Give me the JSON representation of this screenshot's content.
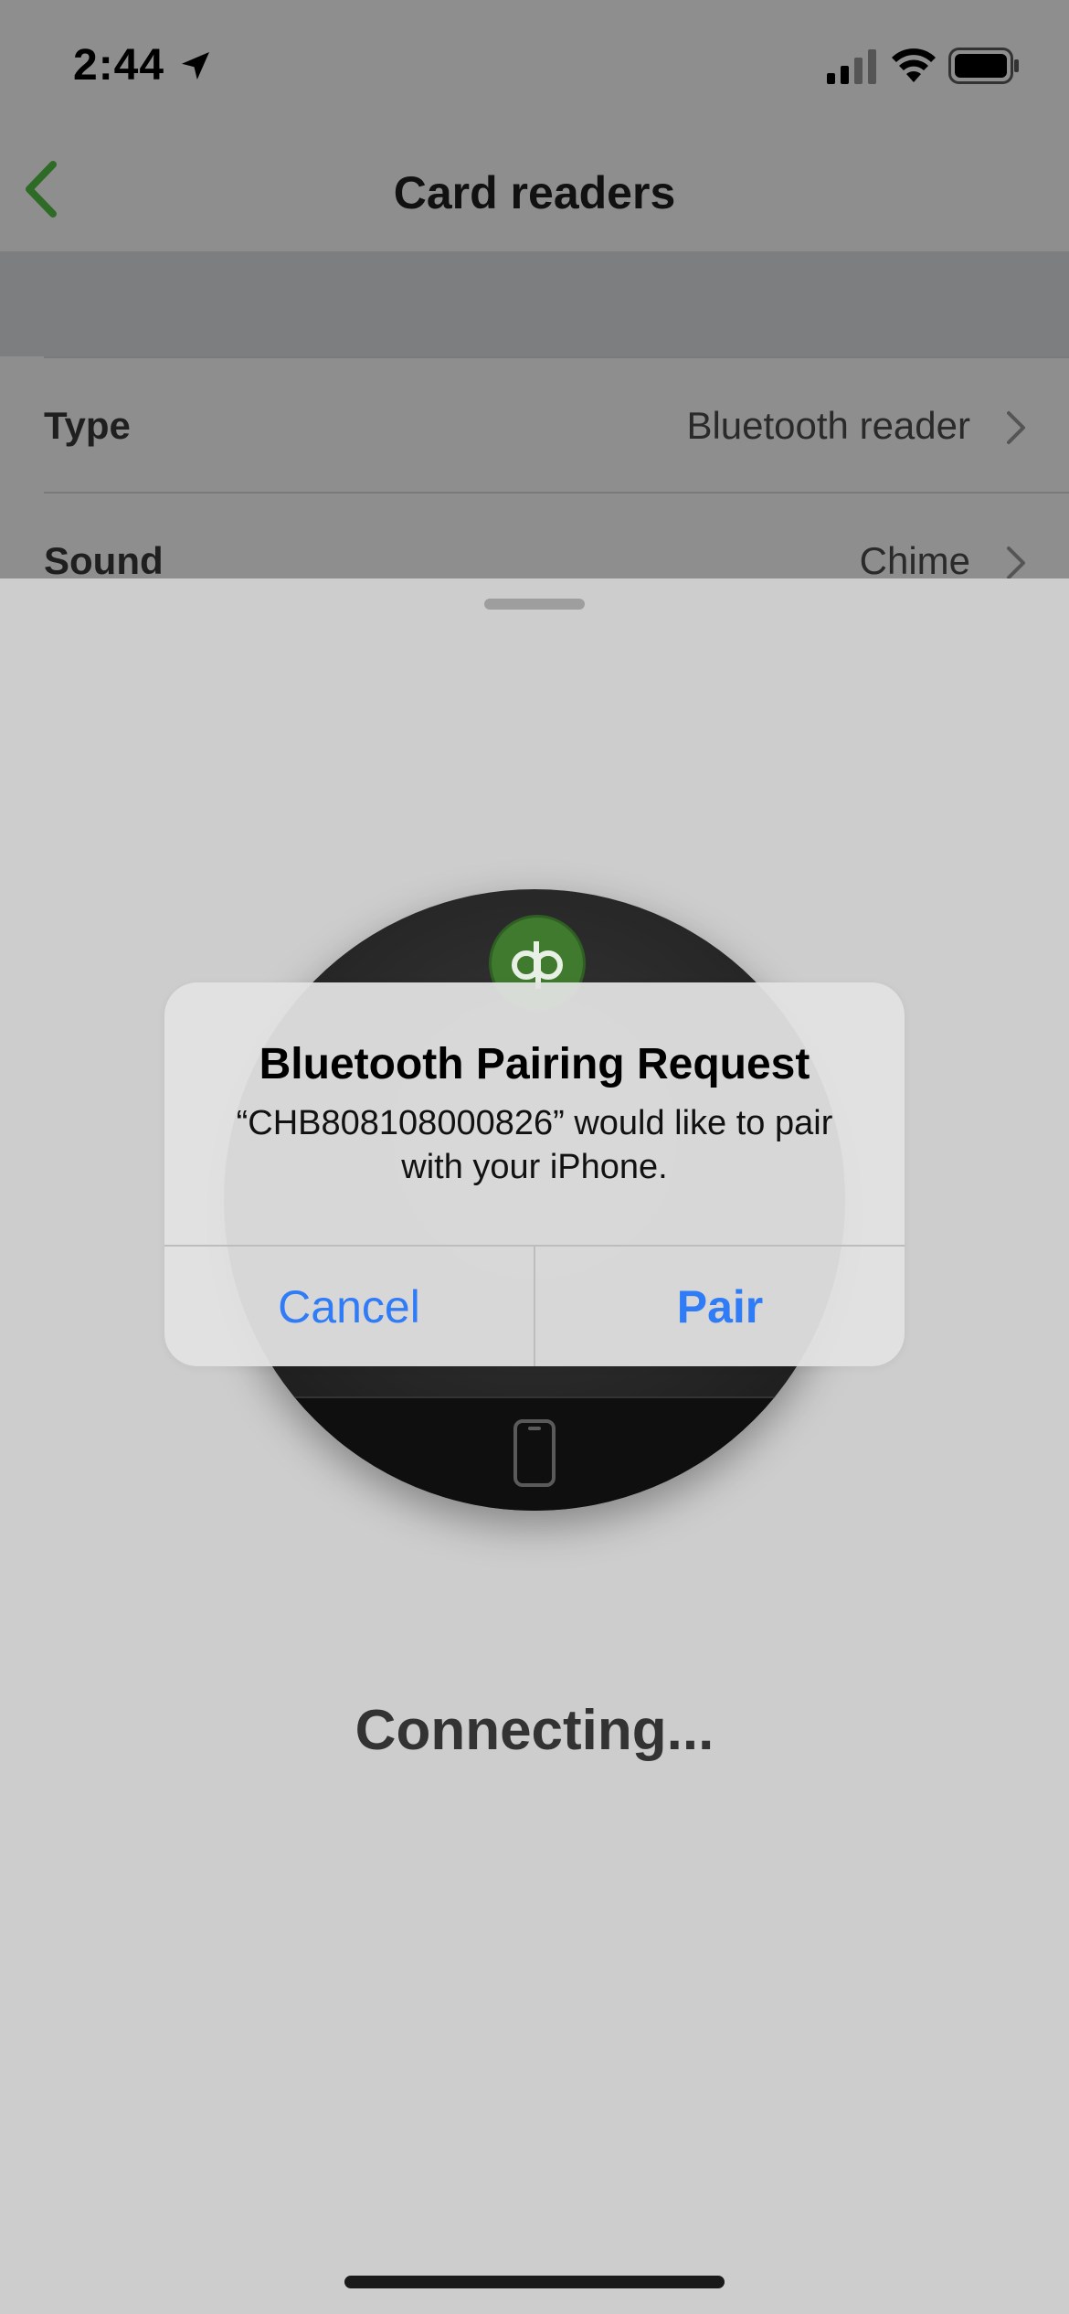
{
  "status_bar": {
    "time": "2:44",
    "icons": [
      "location-arrow-icon",
      "cellular-signal-icon",
      "wifi-icon",
      "battery-icon"
    ]
  },
  "nav": {
    "title": "Card readers",
    "back_icon": "chevron-left-icon",
    "accent_color": "#2e7d32"
  },
  "settings": {
    "rows": [
      {
        "label": "Type",
        "value": "Bluetooth reader"
      },
      {
        "label": "Sound",
        "value": "Chime"
      }
    ]
  },
  "sheet": {
    "status_text": "Connecting..."
  },
  "alert": {
    "title": "Bluetooth Pairing Request",
    "message": "“CHB808108000826” would like to pair with your iPhone.",
    "cancel_label": "Cancel",
    "pair_label": "Pair",
    "button_color": "#2f7cf6"
  }
}
